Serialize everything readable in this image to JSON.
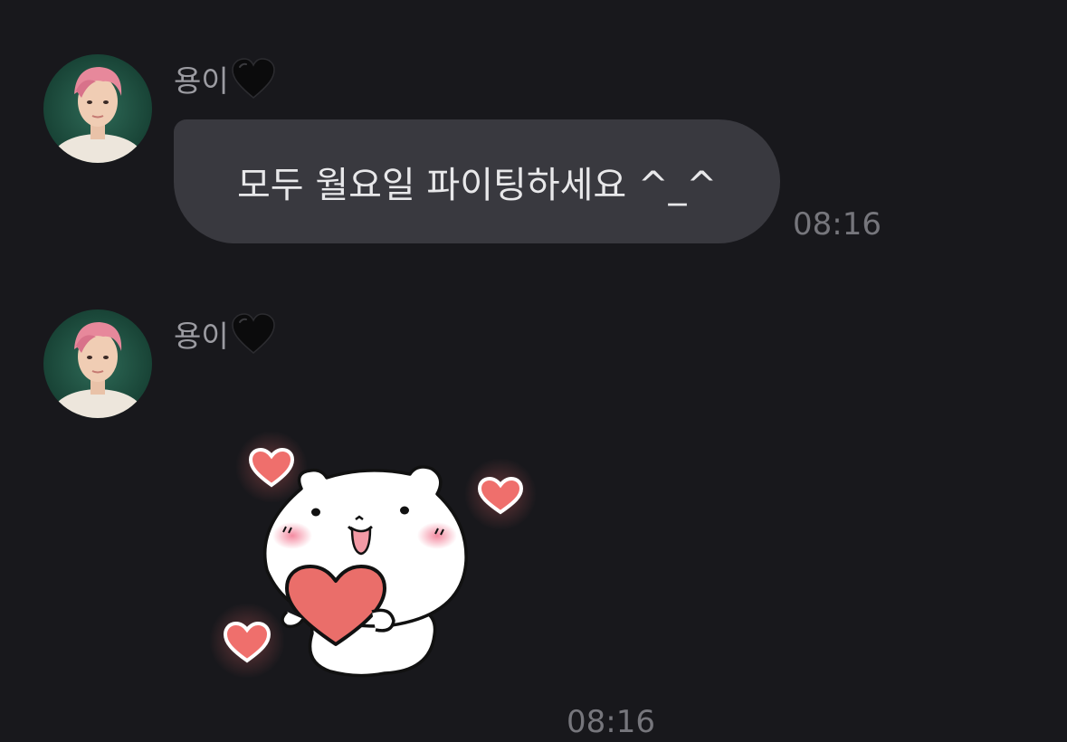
{
  "messages": [
    {
      "sender": "용이",
      "sender_badge_icon": "black-heart-icon",
      "text": "모두 월요일 파이팅하세요 ^_^",
      "time": "08:16"
    },
    {
      "sender": "용이",
      "sender_badge_icon": "black-heart-icon",
      "sticker": "white-bear-holding-heart-sticker",
      "time": "08:16"
    }
  ],
  "colors": {
    "background": "#18181c",
    "bubble": "#39393f",
    "bubble_text": "#e8e8ea",
    "sender_text": "#9c9ca2",
    "time_text": "#76767c",
    "heart_pink": "#ef6f6c"
  }
}
